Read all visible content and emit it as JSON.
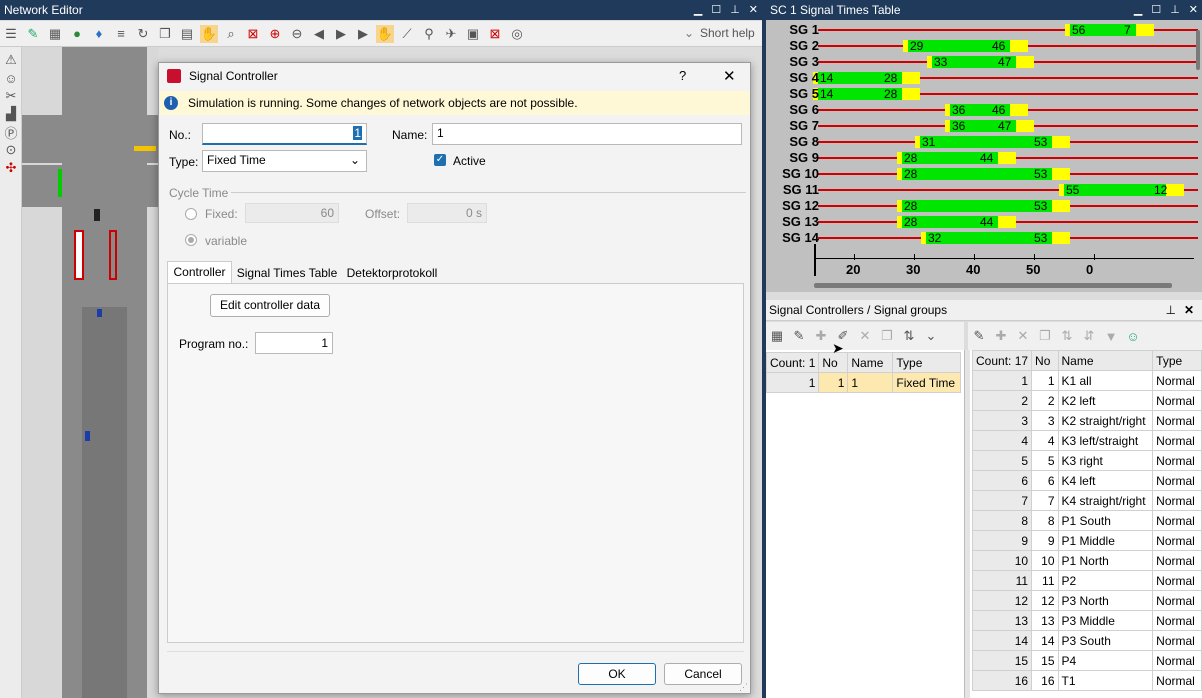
{
  "network_editor": {
    "title": "Network Editor",
    "short_help": "Short help"
  },
  "dialog": {
    "title": "Signal Controller",
    "help": "?",
    "close": "✕",
    "info": "Simulation is running. Some changes of network objects are not possible.",
    "no_label": "No.:",
    "no_value": "1",
    "name_label": "Name:",
    "name_value": "1",
    "type_label": "Type:",
    "type_value": "Fixed Time",
    "active_label": "Active",
    "cycle_time_label": "Cycle Time",
    "fixed_label": "Fixed:",
    "fixed_value": "60",
    "offset_label": "Offset:",
    "offset_value": "0 s",
    "variable_label": "variable",
    "tabs": [
      "Controller",
      "Signal Times Table",
      "Detektorprotokoll"
    ],
    "edit_button": "Edit controller data",
    "program_label": "Program no.:",
    "program_value": "1",
    "ok": "OK",
    "cancel": "Cancel"
  },
  "signal_times": {
    "title": "SC 1 Signal Times Table",
    "rows": [
      {
        "label": "SG  1",
        "n1": "56",
        "n2": "7"
      },
      {
        "label": "SG  2",
        "n1": "29",
        "n2": "46"
      },
      {
        "label": "SG  3",
        "n1": "33",
        "n2": "47"
      },
      {
        "label": "SG  4",
        "n1": "14",
        "n2": "28"
      },
      {
        "label": "SG  5",
        "n1": "14",
        "n2": "28"
      },
      {
        "label": "SG  6",
        "n1": "36",
        "n2": "46"
      },
      {
        "label": "SG  7",
        "n1": "36",
        "n2": "47"
      },
      {
        "label": "SG  8",
        "n1": "31",
        "n2": "53"
      },
      {
        "label": "SG  9",
        "n1": "28",
        "n2": "44"
      },
      {
        "label": "SG 10",
        "n1": "28",
        "n2": "53"
      },
      {
        "label": "SG 11",
        "n1": "55",
        "n2": "12"
      },
      {
        "label": "SG 12",
        "n1": "28",
        "n2": "53"
      },
      {
        "label": "SG 13",
        "n1": "28",
        "n2": "44"
      },
      {
        "label": "SG 14",
        "n1": "32",
        "n2": "53"
      }
    ],
    "axis_ticks": [
      "20",
      "30",
      "40",
      "50",
      "0"
    ],
    "colors": {
      "green": "#00e600",
      "yellow": "#ffff00",
      "red": "#d00000",
      "bg": "#c0c0c0"
    }
  },
  "sc_list": {
    "title": "Signal Controllers / Signal groups",
    "headers": [
      "Count: 1",
      "No",
      "Name",
      "Type"
    ],
    "rows": [
      [
        "1",
        "1",
        "1",
        "Fixed Time"
      ]
    ]
  },
  "sg_list": {
    "headers": [
      "Count: 17",
      "No",
      "Name",
      "Type"
    ],
    "rows": [
      [
        "1",
        "1",
        "K1 all",
        "Normal"
      ],
      [
        "2",
        "2",
        "K2 left",
        "Normal"
      ],
      [
        "3",
        "3",
        "K2 straight/right",
        "Normal"
      ],
      [
        "4",
        "4",
        "K3 left/straight",
        "Normal"
      ],
      [
        "5",
        "5",
        "K3 right",
        "Normal"
      ],
      [
        "6",
        "6",
        "K4 left",
        "Normal"
      ],
      [
        "7",
        "7",
        "K4 straight/right",
        "Normal"
      ],
      [
        "8",
        "8",
        "P1 South",
        "Normal"
      ],
      [
        "9",
        "9",
        "P1 Middle",
        "Normal"
      ],
      [
        "10",
        "10",
        "P1 North",
        "Normal"
      ],
      [
        "11",
        "11",
        "P2",
        "Normal"
      ],
      [
        "12",
        "12",
        "P3 North",
        "Normal"
      ],
      [
        "13",
        "13",
        "P3 Middle",
        "Normal"
      ],
      [
        "14",
        "14",
        "P3 South",
        "Normal"
      ],
      [
        "15",
        "15",
        "P4",
        "Normal"
      ],
      [
        "16",
        "16",
        "T1",
        "Normal"
      ]
    ]
  }
}
